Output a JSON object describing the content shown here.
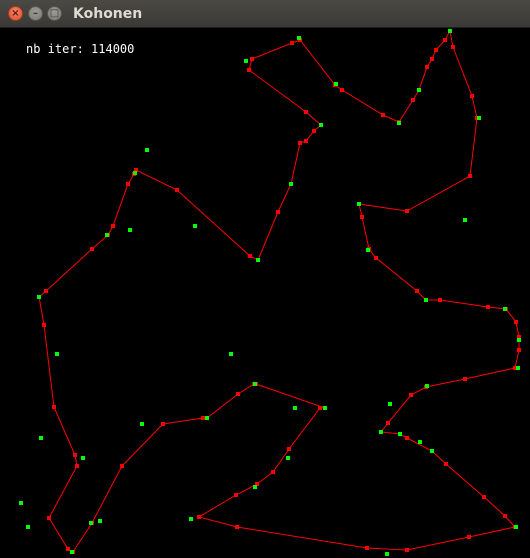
{
  "window": {
    "title": "Kohonen",
    "close_glyph": "×",
    "minimize_glyph": "–",
    "maximize_glyph": "□"
  },
  "status": {
    "iteration_text": "nb iter: 114000"
  },
  "colors": {
    "background": "#000000",
    "ring": "#ff0000",
    "neuron": "#ff0000",
    "city": "#00ff00",
    "text": "#ffffff"
  }
}
